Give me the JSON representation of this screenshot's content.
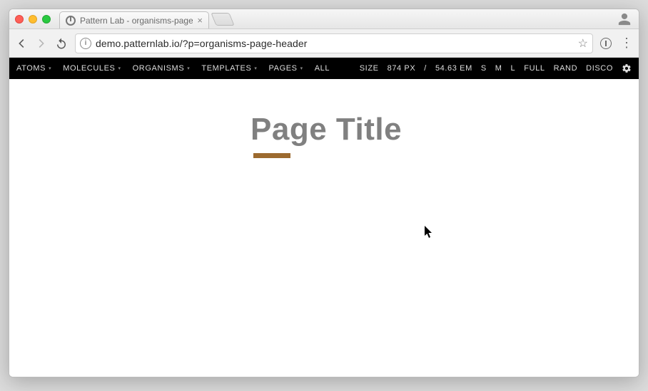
{
  "browser": {
    "tab_title": "Pattern Lab - organisms-page",
    "url": "demo.patternlab.io/?p=organisms-page-header"
  },
  "pl_bar": {
    "nav": [
      "ATOMS",
      "MOLECULES",
      "ORGANISMS",
      "TEMPLATES",
      "PAGES"
    ],
    "all_label": "ALL",
    "size_label": "SIZE",
    "size_px": "874 PX",
    "size_sep": "/",
    "size_em": "54.63 EM",
    "presets": [
      "S",
      "M",
      "L",
      "FULL",
      "RAND",
      "DISCO"
    ]
  },
  "page": {
    "title": "Page Title"
  }
}
